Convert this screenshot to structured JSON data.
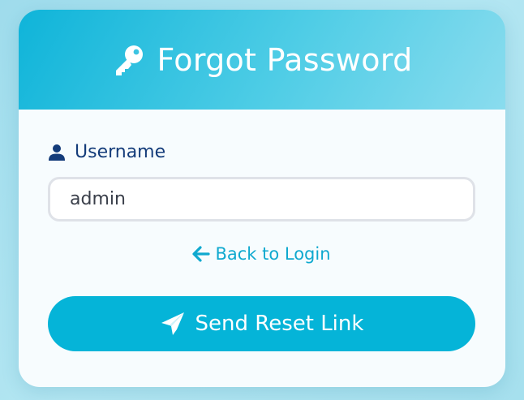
{
  "header": {
    "icon": "key-icon",
    "title": "Forgot Password"
  },
  "form": {
    "username_icon": "user-icon",
    "username_label": "Username",
    "username_value": "admin",
    "back_icon": "arrow-left-icon",
    "back_label": "Back to Login",
    "submit_icon": "paper-plane-icon",
    "submit_label": "Send Reset Link"
  },
  "colors": {
    "accent": "#05b4d8",
    "label": "#143c7a",
    "link": "#0fa9cf",
    "card": "#f7fcfe"
  }
}
